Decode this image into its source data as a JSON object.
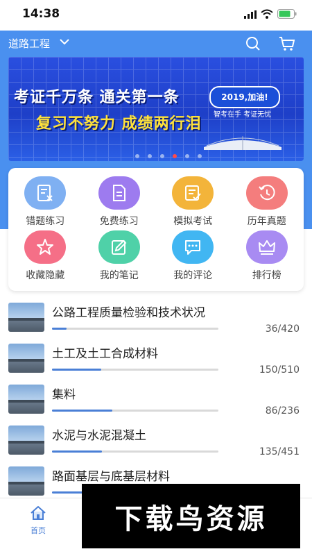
{
  "status_bar": {
    "time": "14:38"
  },
  "topbar": {
    "title": "道路工程"
  },
  "banner": {
    "line1": "考证千万条 通关第一条",
    "line2": "复习不努力 成绩两行泪",
    "badge": "2019,加油!",
    "slogan": "智考在手 考证无忧"
  },
  "functions": [
    {
      "label": "错题练习",
      "color": "#7fb0f2",
      "icon": "error-practice-icon"
    },
    {
      "label": "免费练习",
      "color": "#9d7bef",
      "icon": "free-practice-icon"
    },
    {
      "label": "模拟考试",
      "color": "#f3b43a",
      "icon": "mock-exam-icon"
    },
    {
      "label": "历年真题",
      "color": "#f47d7d",
      "icon": "past-papers-icon"
    },
    {
      "label": "收藏隐藏",
      "color": "#f56f87",
      "icon": "star-icon"
    },
    {
      "label": "我的笔记",
      "color": "#4fd1a8",
      "icon": "notes-icon"
    },
    {
      "label": "我的评论",
      "color": "#41b6f2",
      "icon": "comment-icon"
    },
    {
      "label": "排行榜",
      "color": "#a88bf2",
      "icon": "crown-icon"
    }
  ],
  "chapters": [
    {
      "name": "公路工程质量检验和技术状况",
      "count": "36/420",
      "progress": 0.086
    },
    {
      "name": "土工及土工合成材料",
      "count": "150/510",
      "progress": 0.294
    },
    {
      "name": "集料",
      "count": "86/236",
      "progress": 0.364
    },
    {
      "name": "水泥与水泥混凝土",
      "count": "135/451",
      "progress": 0.299
    },
    {
      "name": "路面基层与底基层材料",
      "count": "",
      "progress": 0.25
    }
  ],
  "tabbar": {
    "home_label": "首页"
  },
  "watermark": "下载鸟资源"
}
